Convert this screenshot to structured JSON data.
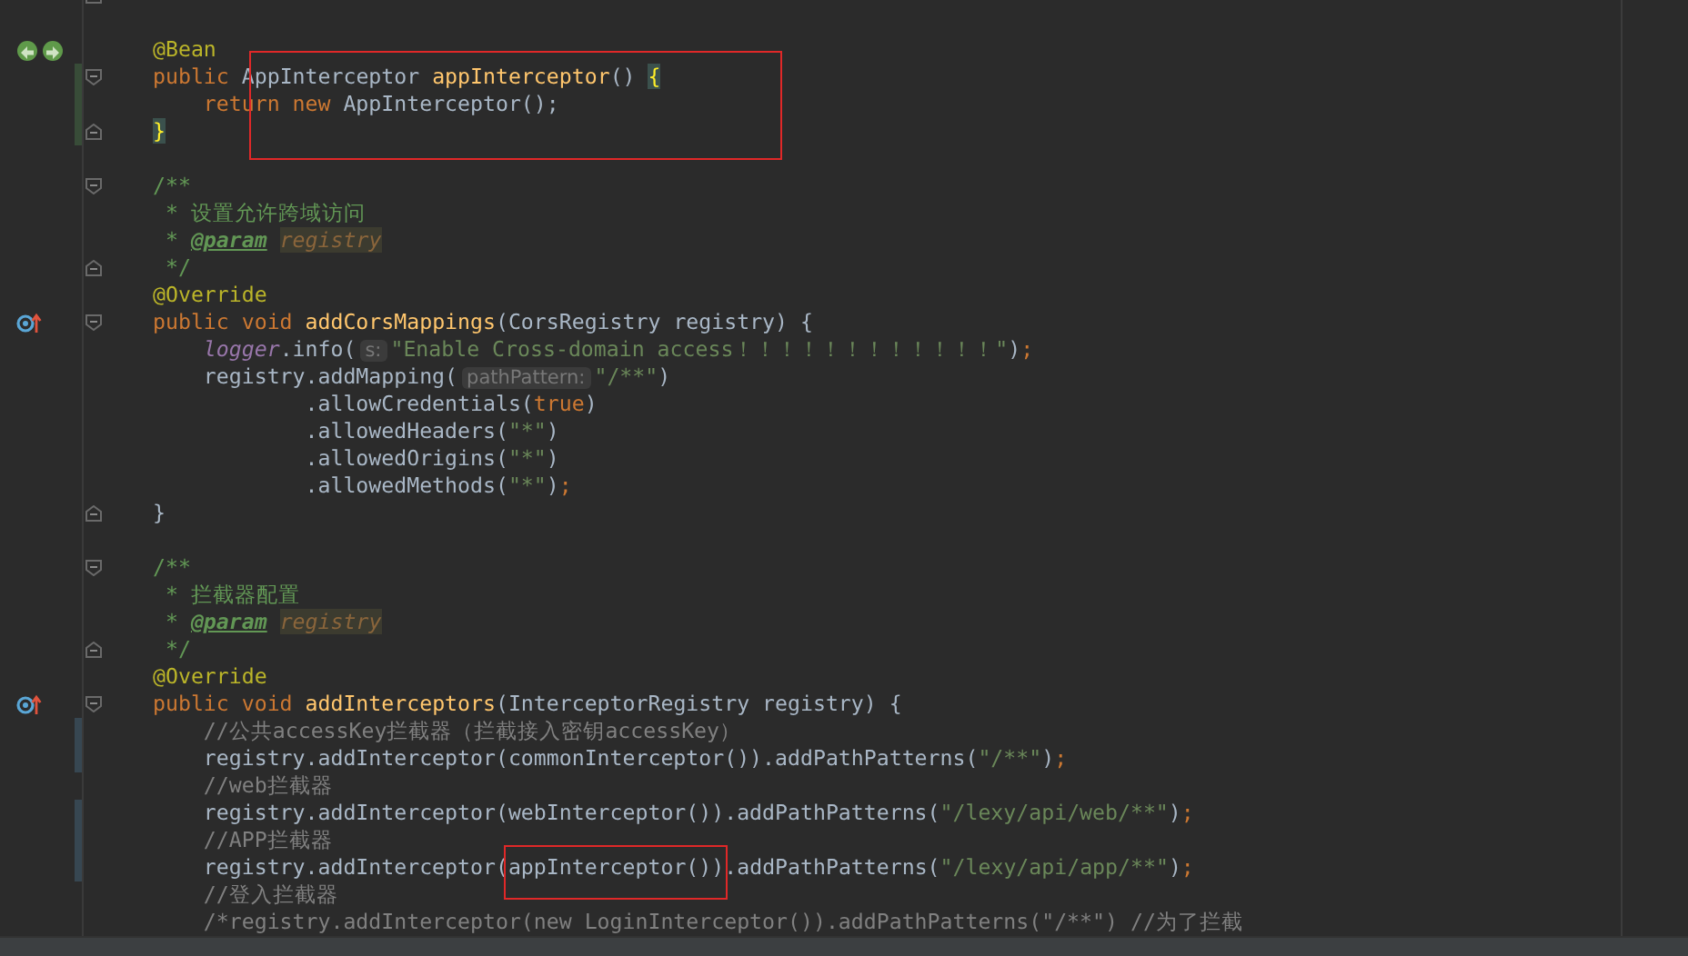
{
  "editor": {
    "lines": [
      {
        "fold_end": true
      },
      {
        "gap_before": true,
        "bean_marker": true,
        "tokens": [
          {
            "kind": "annotation",
            "text": "@Bean"
          }
        ]
      },
      {
        "fold_start": true,
        "added": true,
        "tokens": [
          {
            "kind": "keyword",
            "text": "public "
          },
          {
            "kind": "plain",
            "text": "AppInterceptor ",
            "boxed": true
          },
          {
            "kind": "method",
            "text": "appInterceptor"
          },
          {
            "kind": "plain",
            "text": "() "
          },
          {
            "kind": "brace",
            "text": "{"
          }
        ]
      },
      {
        "added": true,
        "tokens": [
          {
            "kind": "keyword",
            "text": "    return new "
          },
          {
            "kind": "plain",
            "text": "AppInterceptor();"
          }
        ]
      },
      {
        "fold_end": true,
        "added": true,
        "tokens": [
          {
            "kind": "brace",
            "text": "}"
          }
        ]
      },
      {
        "gap_before": true,
        "fold_start": true,
        "tokens": [
          {
            "kind": "doc",
            "text": "/**"
          }
        ]
      },
      {
        "tokens": [
          {
            "kind": "doc",
            "text": " * 设置允许跨域访问"
          }
        ]
      },
      {
        "tokens": [
          {
            "kind": "doc",
            "text": " * "
          },
          {
            "kind": "doctag",
            "text": "@param"
          },
          {
            "kind": "docparam",
            "text": "registry"
          }
        ]
      },
      {
        "fold_end": true,
        "tokens": [
          {
            "kind": "doc",
            "text": " */"
          }
        ]
      },
      {
        "tokens": [
          {
            "kind": "annotation",
            "text": "@Override"
          }
        ]
      },
      {
        "override_marker": true,
        "fold_start": true,
        "tokens": [
          {
            "kind": "keyword",
            "text": "public void "
          },
          {
            "kind": "method",
            "text": "addCorsMappings"
          },
          {
            "kind": "plain",
            "text": "(CorsRegistry registry) {"
          }
        ]
      },
      {
        "tokens": [
          {
            "kind": "field",
            "text": "    logger"
          },
          {
            "kind": "plain",
            "text": ".info("
          },
          {
            "kind": "hint",
            "text": "s:"
          },
          {
            "kind": "string",
            "text": "\"Enable Cross-domain access！！！！！！！！！！！！\""
          },
          {
            "kind": "plain",
            "text": ")"
          },
          {
            "kind": "keyword",
            "text": ";"
          }
        ]
      },
      {
        "tokens": [
          {
            "kind": "plain",
            "text": "    registry.addMapping("
          },
          {
            "kind": "hint",
            "text": "pathPattern:"
          },
          {
            "kind": "string",
            "text": "\"/**\""
          },
          {
            "kind": "plain",
            "text": ")"
          }
        ]
      },
      {
        "tokens": [
          {
            "kind": "plain",
            "text": "            .allowCredentials("
          },
          {
            "kind": "keyword",
            "text": "true"
          },
          {
            "kind": "plain",
            "text": ")"
          }
        ]
      },
      {
        "tokens": [
          {
            "kind": "plain",
            "text": "            .allowedHeaders("
          },
          {
            "kind": "string",
            "text": "\"*\""
          },
          {
            "kind": "plain",
            "text": ")"
          }
        ]
      },
      {
        "tokens": [
          {
            "kind": "plain",
            "text": "            .allowedOrigins("
          },
          {
            "kind": "string",
            "text": "\"*\""
          },
          {
            "kind": "plain",
            "text": ")"
          }
        ]
      },
      {
        "tokens": [
          {
            "kind": "plain",
            "text": "            .allowedMethods("
          },
          {
            "kind": "string",
            "text": "\"*\""
          },
          {
            "kind": "plain",
            "text": ")"
          },
          {
            "kind": "keyword",
            "text": ";"
          }
        ]
      },
      {
        "fold_end": true,
        "tokens": [
          {
            "kind": "plain",
            "text": "}"
          }
        ]
      },
      {
        "gap_before": true,
        "fold_start": true,
        "tokens": [
          {
            "kind": "doc",
            "text": "/**"
          }
        ]
      },
      {
        "tokens": [
          {
            "kind": "doc",
            "text": " * 拦截器配置"
          }
        ]
      },
      {
        "tokens": [
          {
            "kind": "doc",
            "text": " * "
          },
          {
            "kind": "doctag",
            "text": "@param"
          },
          {
            "kind": "docparam",
            "text": "registry"
          }
        ]
      },
      {
        "fold_end": true,
        "tokens": [
          {
            "kind": "doc",
            "text": " */"
          }
        ]
      },
      {
        "tokens": [
          {
            "kind": "annotation",
            "text": "@Override"
          }
        ]
      },
      {
        "override_marker": true,
        "fold_start": true,
        "tokens": [
          {
            "kind": "keyword",
            "text": "public void "
          },
          {
            "kind": "method",
            "text": "addInterceptors"
          },
          {
            "kind": "plain",
            "text": "(InterceptorRegistry registry) {"
          }
        ]
      },
      {
        "modified": true,
        "tokens": [
          {
            "kind": "comment",
            "text": "    //公共accessKey拦截器（拦截接入密钥accessKey）"
          }
        ]
      },
      {
        "modified": true,
        "tokens": [
          {
            "kind": "plain",
            "text": "    registry.addInterceptor(commonInterceptor()).addPathPatterns("
          },
          {
            "kind": "string",
            "text": "\"/**\""
          },
          {
            "kind": "plain",
            "text": ")"
          },
          {
            "kind": "keyword",
            "text": ";"
          }
        ]
      },
      {
        "tokens": [
          {
            "kind": "comment",
            "text": "    //web拦截器"
          }
        ]
      },
      {
        "modified": true,
        "tokens": [
          {
            "kind": "plain",
            "text": "    registry.addInterceptor(webInterceptor()).addPathPatterns("
          },
          {
            "kind": "string",
            "text": "\"/lexy/api/web/**\""
          },
          {
            "kind": "plain",
            "text": ")"
          },
          {
            "kind": "keyword",
            "text": ";"
          }
        ]
      },
      {
        "modified": true,
        "tokens": [
          {
            "kind": "comment",
            "text": "    //APP拦截器"
          }
        ]
      },
      {
        "modified": true,
        "tokens": [
          {
            "kind": "plain",
            "text": "    registry.addInterceptor("
          },
          {
            "kind": "plain",
            "text": "appInterceptor())",
            "boxed": true
          },
          {
            "kind": "plain",
            "text": ".addPathPatterns("
          },
          {
            "kind": "string",
            "text": "\"/lexy/api/app/**\""
          },
          {
            "kind": "plain",
            "text": ")"
          },
          {
            "kind": "keyword",
            "text": ";"
          }
        ]
      },
      {
        "tokens": [
          {
            "kind": "comment",
            "text": "    //登入拦截器"
          }
        ]
      },
      {
        "tokens": [
          {
            "kind": "comment",
            "text": "    /*registry.addInterceptor(new LoginInterceptor()).addPathPatterns(\"/**\") //为了拦截"
          }
        ]
      }
    ]
  }
}
